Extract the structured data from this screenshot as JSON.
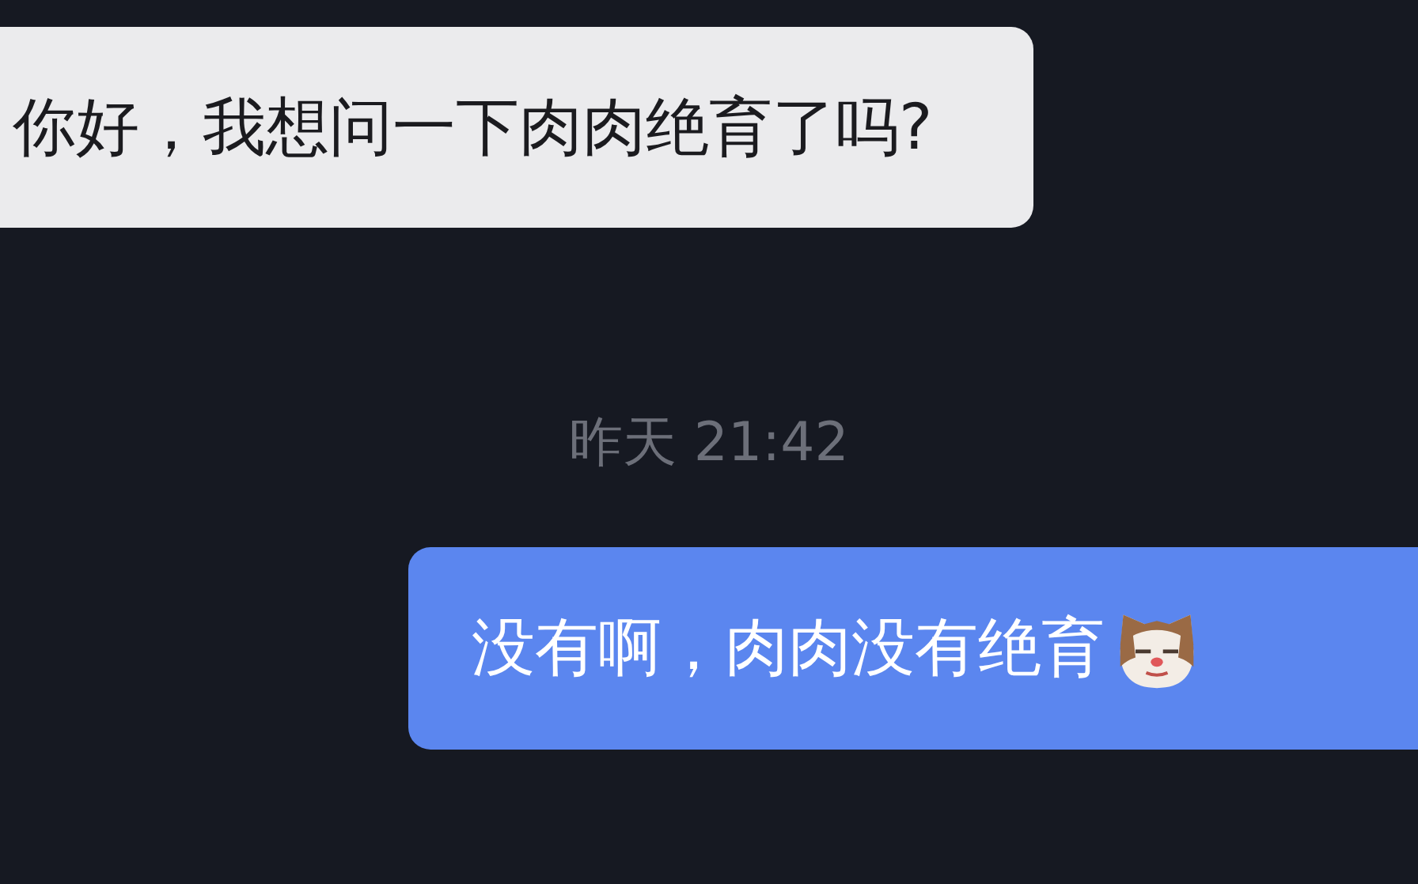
{
  "messages": [
    {
      "kind": "incoming",
      "text": "你好，我想问一下肉肉绝育了吗?"
    },
    {
      "kind": "timestamp",
      "text": "昨天 21:42"
    },
    {
      "kind": "outgoing",
      "text": "没有啊，肉肉没有绝育",
      "emoji": true
    }
  ]
}
